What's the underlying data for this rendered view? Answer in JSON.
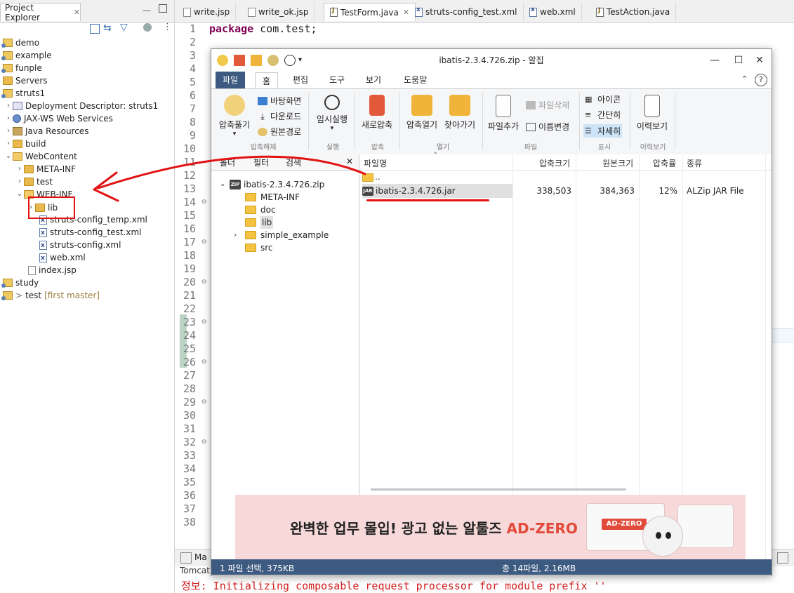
{
  "project_explorer": {
    "title": "Project Explorer",
    "items": [
      {
        "label": "demo",
        "icon": "project-icon"
      },
      {
        "label": "example",
        "icon": "project-icon"
      },
      {
        "label": "funple",
        "icon": "project-icon"
      },
      {
        "label": "Servers",
        "icon": "folder-icon"
      },
      {
        "label": "struts1",
        "icon": "project-icon"
      },
      {
        "label": "Deployment Descriptor: struts1",
        "icon": "deployment-descriptor-icon"
      },
      {
        "label": "JAX-WS Web Services",
        "icon": "web-services-icon"
      },
      {
        "label": "Java Resources",
        "icon": "java-resources-icon"
      },
      {
        "label": "build",
        "icon": "folder-icon"
      },
      {
        "label": "WebContent",
        "icon": "folder-icon"
      },
      {
        "label": "META-INF",
        "icon": "folder-icon"
      },
      {
        "label": "test",
        "icon": "folder-icon"
      },
      {
        "label": "WEB-INF",
        "icon": "folder-icon"
      },
      {
        "label": "lib",
        "icon": "folder-icon"
      },
      {
        "label": "struts-config_temp.xml",
        "icon": "xml-file-icon"
      },
      {
        "label": "struts-config_test.xml",
        "icon": "xml-file-icon"
      },
      {
        "label": "struts-config.xml",
        "icon": "xml-file-icon"
      },
      {
        "label": "web.xml",
        "icon": "xml-file-icon"
      },
      {
        "label": "index.jsp",
        "icon": "jsp-file-icon"
      },
      {
        "label": "study",
        "icon": "project-icon"
      },
      {
        "label": "test",
        "icon": "project-icon"
      }
    ],
    "git_hint": "[first master]",
    "git_prefix": ">"
  },
  "editor_tabs": [
    {
      "label": "write.jsp"
    },
    {
      "label": "write_ok.jsp"
    },
    {
      "label": "TestForm.java",
      "close": "✕"
    },
    {
      "label": "struts-config_test.xml"
    },
    {
      "label": "web.xml"
    },
    {
      "label": "TestAction.java"
    }
  ],
  "editor": {
    "line_numbers": [
      "1",
      "2",
      "3",
      "4",
      "5",
      "6",
      "7",
      "8",
      "9",
      "10",
      "11",
      "12",
      "13",
      "14",
      "15",
      "16",
      "17",
      "18",
      "19",
      "20",
      "21",
      "22",
      "23",
      "24",
      "25",
      "26",
      "27",
      "28",
      "29",
      "30",
      "31",
      "32",
      "33",
      "34",
      "35",
      "36",
      "37",
      "38"
    ],
    "code_keyword": "package",
    "code_rest": " com.test;"
  },
  "console": {
    "tab_label": "Ma",
    "server_label": "Tomcat",
    "message": "정보: Initializing composable request processor for module prefix ''"
  },
  "alzip": {
    "title": "ibatis-2.3.4.726.zip - 알집",
    "menus": [
      "파일",
      "홈",
      "편집",
      "도구",
      "보기",
      "도움말"
    ],
    "ribbon": {
      "extract_label": "압축풀기",
      "desktop_label": "바탕화면",
      "downloads_label": "다운로드",
      "original_path_label": "원본경로",
      "group_extract": "압축해제",
      "temp_run_label": "임시실행",
      "group_run": "실행",
      "new_zip_label": "새로압축",
      "group_compress": "압축",
      "open_zip_label": "압축열기",
      "find_label": "찾아가기",
      "group_open": "열기",
      "add_file_label": "파일추가",
      "delete_file_label": "파일삭제",
      "rename_label": "이름변경",
      "group_file": "파일",
      "icon_view_label": "아이콘",
      "simple_view_label": "간단히",
      "detail_view_label": "자세히",
      "group_view": "표시",
      "history_label": "이력보기",
      "group_history": "이력보기"
    },
    "left_tabs": [
      "폴더",
      "필터",
      "검색"
    ],
    "left_close": "✕",
    "tree": [
      {
        "label": "ibatis-2.3.4.726.zip",
        "type": "zip"
      },
      {
        "label": "META-INF",
        "type": "folder"
      },
      {
        "label": "doc",
        "type": "folder"
      },
      {
        "label": "lib",
        "type": "folder"
      },
      {
        "label": "simple_example",
        "type": "folder"
      },
      {
        "label": "src",
        "type": "folder"
      }
    ],
    "list_headers": [
      "파일명",
      "압축크기",
      "원본크기",
      "압축률",
      "종류"
    ],
    "rows": [
      {
        "name": "..",
        "compressed": "",
        "original": "",
        "ratio": "",
        "type": ""
      },
      {
        "name": "ibatis-2.3.4.726.jar",
        "compressed": "338,503",
        "original": "384,363",
        "ratio": "12%",
        "type": "ALZip JAR File"
      }
    ],
    "ad": {
      "text_main": "완벽한 업무 몰입! 광고 없는 알툴즈 ",
      "text_brand": "AD-ZERO",
      "badge": "AD-ZERO"
    },
    "status_left": "1 파일 선택,  375KB",
    "status_center": "총 14파일,  2.16MB"
  },
  "colors": {
    "annotation_red": "#e21212",
    "alzip_blue": "#3d5a80",
    "keyword": "#7f0055"
  }
}
